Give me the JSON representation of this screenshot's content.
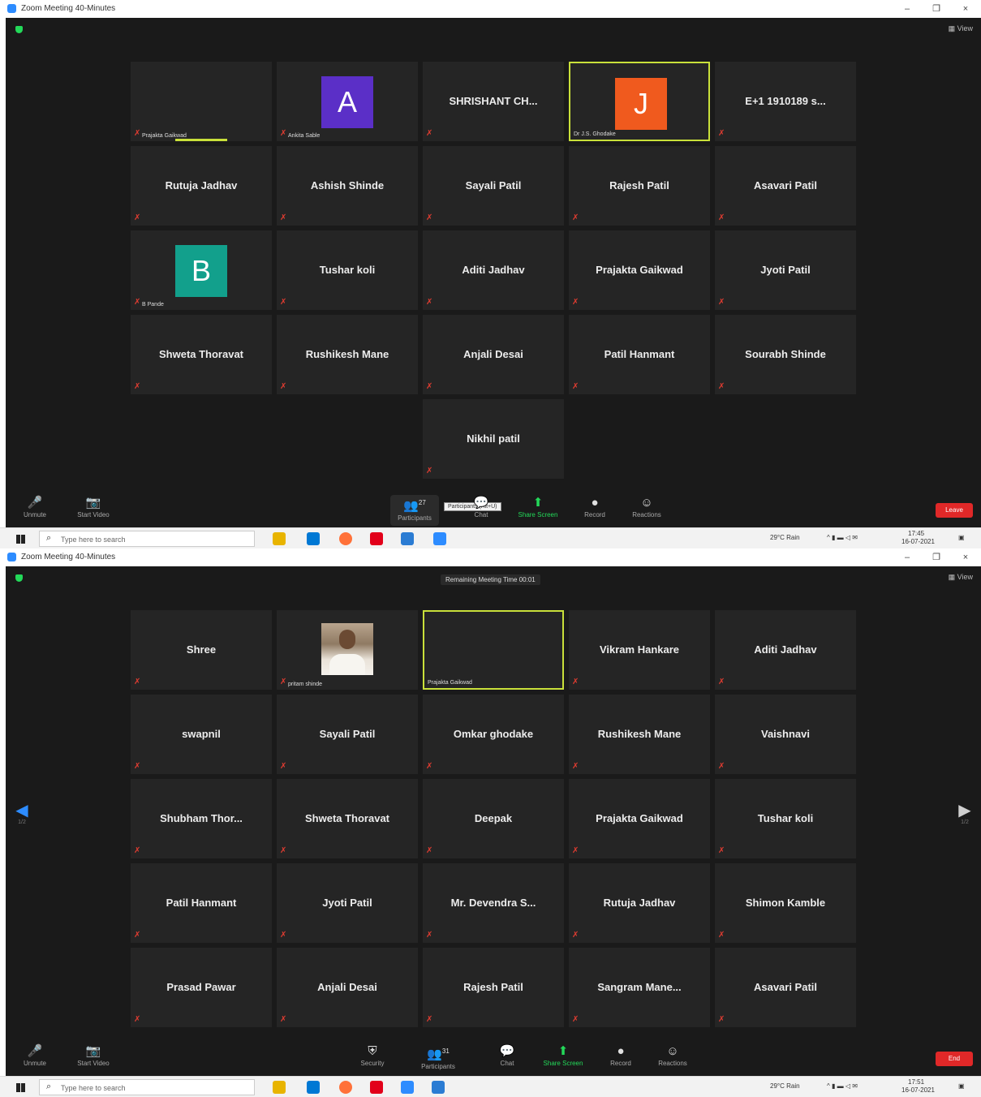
{
  "window_title": "Zoom Meeting 40-Minutes",
  "view_label": "View",
  "top_screenshot": {
    "tiles": [
      {
        "name": "",
        "small_name": "Prajakta Gaikwad",
        "active": false,
        "avatar": null
      },
      {
        "name": "",
        "small_name": "Ankita Sable",
        "active": false,
        "avatar": {
          "letter": "A",
          "color": "#5b2fc7"
        }
      },
      {
        "name": "SHRISHANT CH...",
        "small_name": "",
        "active": false,
        "avatar": null
      },
      {
        "name": "",
        "small_name": "Dr J.S. Ghodake",
        "active": true,
        "avatar": {
          "letter": "J",
          "color": "#f05a1e"
        }
      },
      {
        "name": "E+1 1910189 s...",
        "small_name": "",
        "active": false,
        "avatar": null
      },
      {
        "name": "Rutuja Jadhav",
        "small_name": "",
        "active": false,
        "avatar": null
      },
      {
        "name": "Ashish Shinde",
        "small_name": "",
        "active": false,
        "avatar": null
      },
      {
        "name": "Sayali Patil",
        "small_name": "",
        "active": false,
        "avatar": null
      },
      {
        "name": "Rajesh Patil",
        "small_name": "",
        "active": false,
        "avatar": null
      },
      {
        "name": "Asavari Patil",
        "small_name": "",
        "active": false,
        "avatar": null
      },
      {
        "name": "",
        "small_name": "B Pande",
        "active": false,
        "avatar": {
          "letter": "B",
          "color": "#12a08c"
        }
      },
      {
        "name": "Tushar koli",
        "small_name": "",
        "active": false,
        "avatar": null
      },
      {
        "name": "Aditi Jadhav",
        "small_name": "",
        "active": false,
        "avatar": null
      },
      {
        "name": "Prajakta Gaikwad",
        "small_name": "",
        "active": false,
        "avatar": null
      },
      {
        "name": "Jyoti Patil",
        "small_name": "",
        "active": false,
        "avatar": null
      },
      {
        "name": "Shweta Thoravat",
        "small_name": "",
        "active": false,
        "avatar": null
      },
      {
        "name": "Rushikesh Mane",
        "small_name": "",
        "active": false,
        "avatar": null
      },
      {
        "name": "Anjali Desai",
        "small_name": "",
        "active": false,
        "avatar": null
      },
      {
        "name": "Patil Hanmant",
        "small_name": "",
        "active": false,
        "avatar": null
      },
      {
        "name": "Sourabh Shinde",
        "small_name": "",
        "active": false,
        "avatar": null
      },
      {
        "name": "Nikhil patil",
        "small_name": "",
        "active": false,
        "avatar": null
      }
    ],
    "toolbar": {
      "unmute": "Unmute",
      "start_video": "Start Video",
      "participants": "Participants",
      "participant_count": "27",
      "tooltip": "Participants (Alt+U)",
      "chat": "Chat",
      "share_screen": "Share Screen",
      "record": "Record",
      "reactions": "Reactions",
      "end": "Leave"
    }
  },
  "bottom_screenshot": {
    "remaining_time": "Remaining Meeting Time 00:01",
    "tiles": [
      {
        "name": "Shree",
        "small_name": "",
        "active": false,
        "photo": false
      },
      {
        "name": "",
        "small_name": "pritam shinde",
        "active": false,
        "photo": true
      },
      {
        "name": "",
        "small_name": "Prajakta Gaikwad",
        "active": true,
        "photo": false
      },
      {
        "name": "Vikram Hankare",
        "small_name": "",
        "active": false,
        "photo": false
      },
      {
        "name": "Aditi Jadhav",
        "small_name": "",
        "active": false,
        "photo": false
      },
      {
        "name": "swapnil",
        "small_name": "",
        "active": false,
        "photo": false
      },
      {
        "name": "Sayali Patil",
        "small_name": "",
        "active": false,
        "photo": false
      },
      {
        "name": "Omkar ghodake",
        "small_name": "",
        "active": false,
        "photo": false
      },
      {
        "name": "Rushikesh Mane",
        "small_name": "",
        "active": false,
        "photo": false
      },
      {
        "name": "Vaishnavi",
        "small_name": "",
        "active": false,
        "photo": false
      },
      {
        "name": "Shubham Thor...",
        "small_name": "",
        "active": false,
        "photo": false
      },
      {
        "name": "Shweta Thoravat",
        "small_name": "",
        "active": false,
        "photo": false
      },
      {
        "name": "Deepak",
        "small_name": "",
        "active": false,
        "photo": false
      },
      {
        "name": "Prajakta Gaikwad",
        "small_name": "",
        "active": false,
        "photo": false
      },
      {
        "name": "Tushar koli",
        "small_name": "",
        "active": false,
        "photo": false
      },
      {
        "name": "Patil Hanmant",
        "small_name": "",
        "active": false,
        "photo": false
      },
      {
        "name": "Jyoti Patil",
        "small_name": "",
        "active": false,
        "photo": false
      },
      {
        "name": "Mr. Devendra S...",
        "small_name": "",
        "active": false,
        "photo": false
      },
      {
        "name": "Rutuja Jadhav",
        "small_name": "",
        "active": false,
        "photo": false
      },
      {
        "name": "Shimon Kamble",
        "small_name": "",
        "active": false,
        "photo": false
      },
      {
        "name": "Prasad Pawar",
        "small_name": "",
        "active": false,
        "photo": false
      },
      {
        "name": "Anjali Desai",
        "small_name": "",
        "active": false,
        "photo": false
      },
      {
        "name": "Rajesh Patil",
        "small_name": "",
        "active": false,
        "photo": false
      },
      {
        "name": "Sangram Mane...",
        "small_name": "",
        "active": false,
        "photo": false
      },
      {
        "name": "Asavari Patil",
        "small_name": "",
        "active": false,
        "photo": false
      }
    ],
    "page_left": "1/2",
    "page_right": "1/2",
    "toolbar": {
      "unmute": "Unmute",
      "start_video": "Start Video",
      "security": "Security",
      "participants": "Participants",
      "participant_count": "31",
      "chat": "Chat",
      "share_screen": "Share Screen",
      "record": "Record",
      "reactions": "Reactions",
      "end": "End"
    }
  },
  "taskbar": {
    "search_placeholder": "Type here to search",
    "weather": "29°C Rain",
    "time_top": "17:45",
    "date_top": "16-07-2021",
    "time_bottom": "17:51",
    "date_bottom": "16-07-2021"
  },
  "colors": {
    "meeting_bg": "#1a1a1a",
    "tile_bg": "#252525",
    "active_border": "#c9e03a",
    "share_green": "#23d959",
    "end_red": "#e02828",
    "muted_red": "#e03c31"
  }
}
